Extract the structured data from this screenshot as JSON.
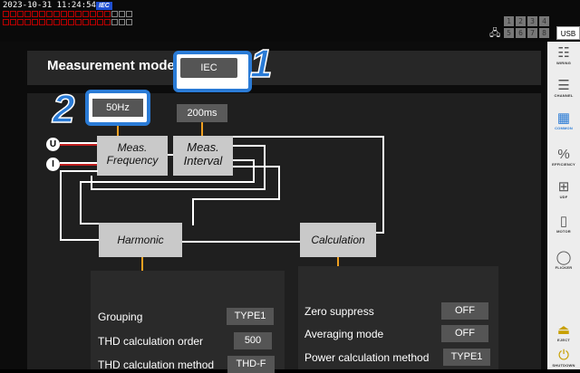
{
  "status": {
    "timestamp": "2023-10-31 11:24:54",
    "mode_badge": "IEC",
    "channel_numbers_top": [
      "1",
      "2",
      "3",
      "4"
    ],
    "channel_numbers_bottom": [
      "5",
      "6",
      "7",
      "8"
    ],
    "usb": "USB"
  },
  "measurement_mode": {
    "label": "Measurement mode",
    "value": "IEC"
  },
  "callouts": {
    "one": "1",
    "two": "2"
  },
  "settings": {
    "frequency_btn": "50Hz",
    "interval_btn": "200ms"
  },
  "inputs": {
    "u": "U",
    "i": "I"
  },
  "diagram": {
    "meas_frequency": [
      "Meas.",
      "Frequency"
    ],
    "meas_interval": [
      "Meas.",
      "Interval"
    ],
    "harmonic": "Harmonic",
    "calculation": "Calculation"
  },
  "harmonic_panel": {
    "grouping_label": "Grouping",
    "grouping_value": "TYPE1",
    "thd_order_label": "THD calculation order",
    "thd_order_value": "500",
    "thd_method_label": "THD calculation method",
    "thd_method_value": "THD-F"
  },
  "calc_panel": {
    "zero_label": "Zero suppress",
    "zero_value": "OFF",
    "avg_label": "Averaging mode",
    "avg_value": "OFF",
    "power_label": "Power calculation method",
    "power_value": "TYPE1"
  },
  "sidebar": {
    "items": [
      {
        "label": "WIRING",
        "icon": "wiring-icon"
      },
      {
        "label": "CHANNEL",
        "icon": "channel-icon"
      },
      {
        "label": "COMMON",
        "icon": "common-icon"
      },
      {
        "label": "EFFICIENCY",
        "icon": "efficiency-icon"
      },
      {
        "label": "UDF",
        "icon": "udf-icon"
      },
      {
        "label": "MOTOR",
        "icon": "motor-icon"
      },
      {
        "label": "FLICKER",
        "icon": "flicker-icon"
      },
      {
        "label": "EJECT",
        "icon": "eject-icon"
      },
      {
        "label": "SHUTDOWN",
        "icon": "shutdown-icon"
      }
    ]
  },
  "colors": {
    "accent": "#2a7bd6",
    "orange": "#f0a020",
    "yellow": "#e8c000"
  }
}
